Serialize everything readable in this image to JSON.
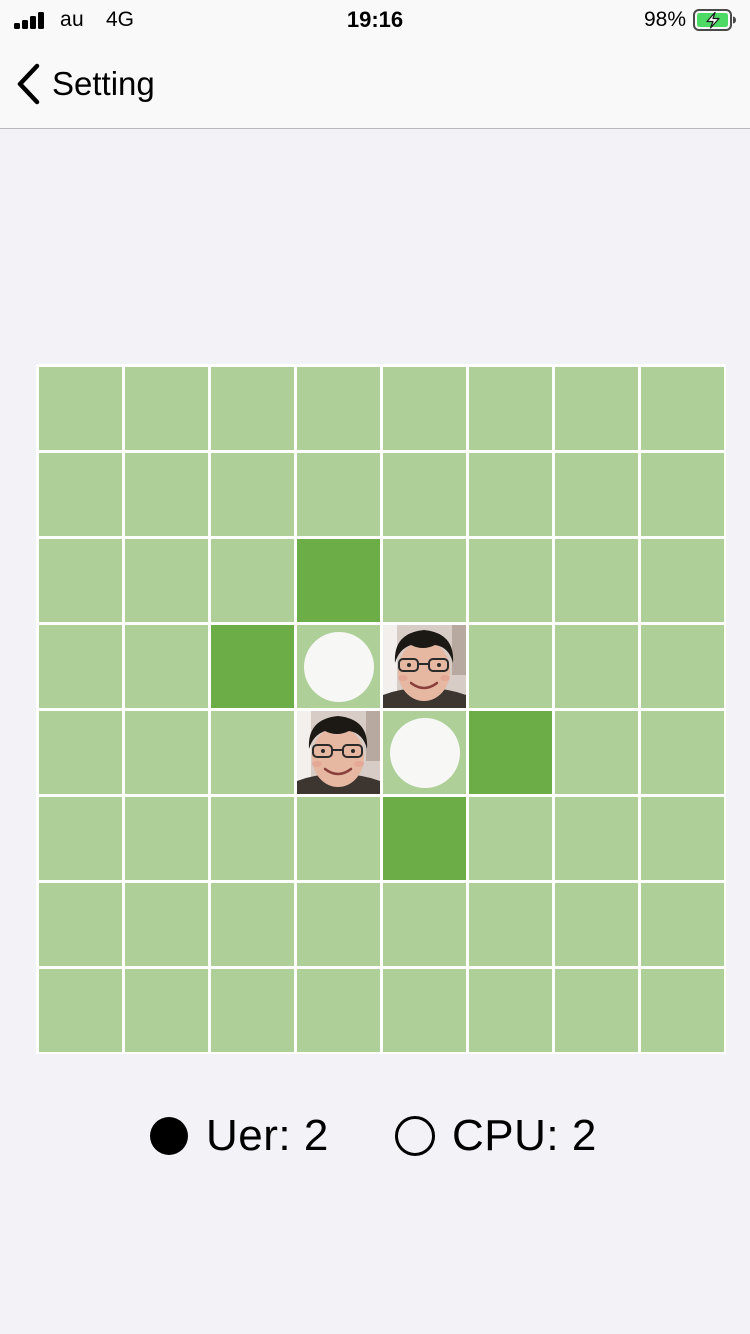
{
  "status_bar": {
    "carrier": "au",
    "network": "4G",
    "time": "19:16",
    "battery_percent": "98%",
    "battery_icon": "battery-charging-icon",
    "signal_icon": "signal-bars-icon"
  },
  "nav": {
    "back_label": "Setting",
    "back_icon": "chevron-left-icon"
  },
  "colors": {
    "page_background": "#f2f2f7",
    "cell": "#aecf98",
    "hint_cell": "#6dad47",
    "grid_lines": "#ffffff",
    "white_disc": "#f7f7f5",
    "battery_fill": "#4cd964"
  },
  "board": {
    "size": 8,
    "legend": {
      "empty": ".",
      "hint": "h",
      "white_disc": "W",
      "user_photo_piece": "P"
    },
    "rows": [
      "........",
      "........",
      "...h....",
      "..hWP...",
      "...PWh..",
      "....h...",
      "........",
      "........"
    ]
  },
  "score": {
    "user_label": "Uer: 2",
    "cpu_label": "CPU: 2",
    "user_marker": "filled-circle-icon",
    "cpu_marker": "hollow-circle-icon"
  }
}
